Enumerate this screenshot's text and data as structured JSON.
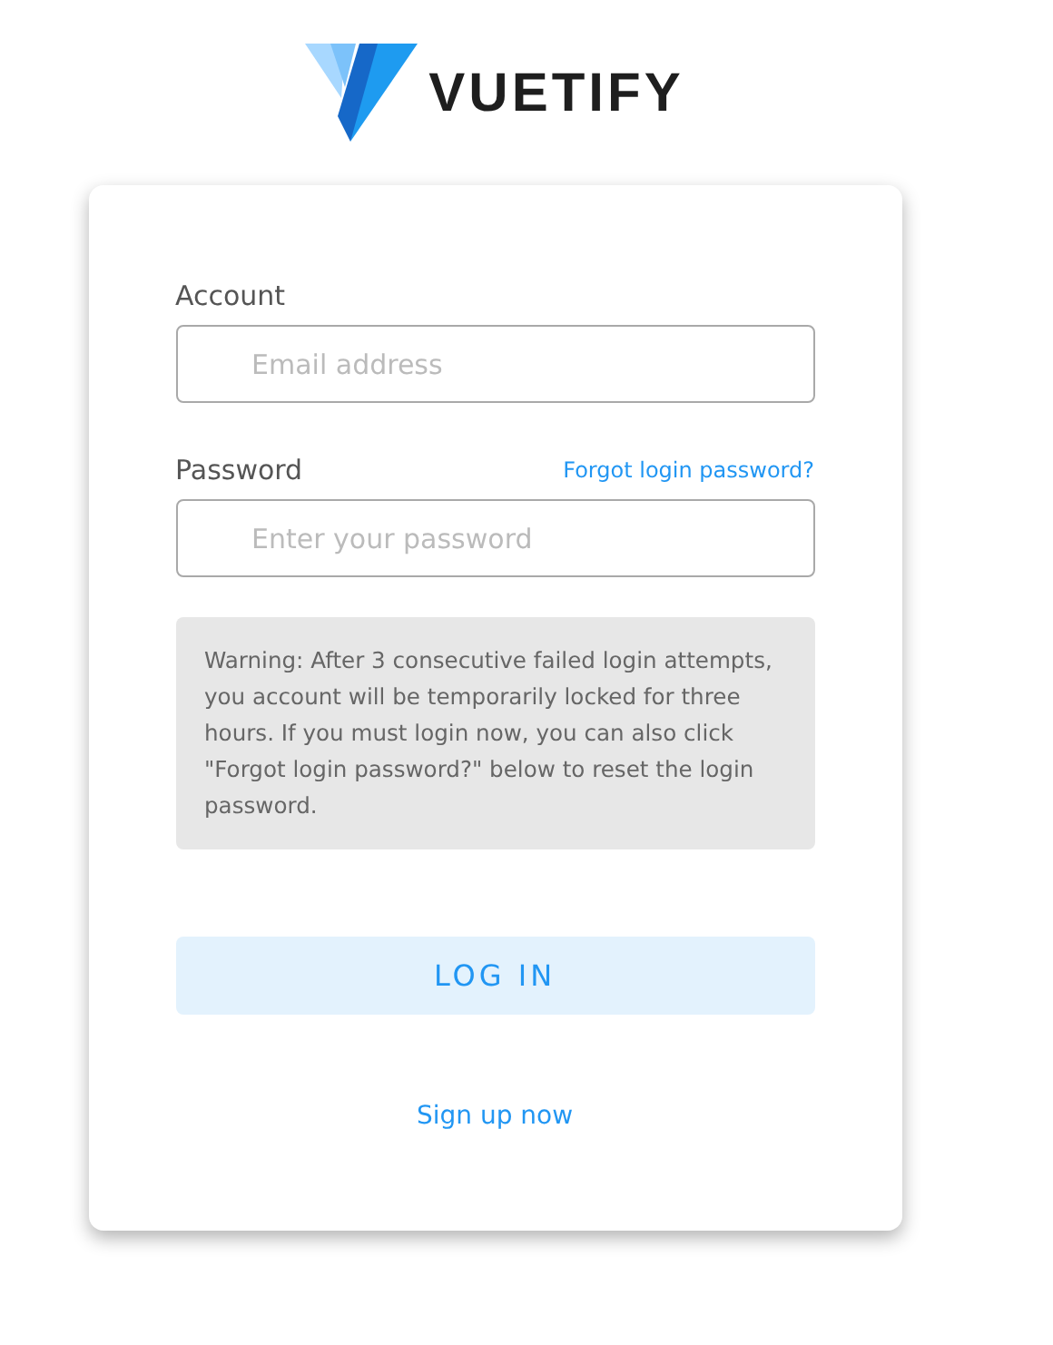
{
  "logo": {
    "text": "VUETIFY"
  },
  "account": {
    "label": "Account",
    "placeholder": "Email address"
  },
  "password": {
    "label": "Password",
    "placeholder": "Enter your password",
    "forgot_link": "Forgot login password?"
  },
  "warning": "Warning: After 3 consecutive failed login attempts, you account will be temporarily locked for three hours. If you must login now, you can also click \"Forgot login password?\" below to reset the login password.",
  "login_button": "LOG IN",
  "signup_link": "Sign up now"
}
